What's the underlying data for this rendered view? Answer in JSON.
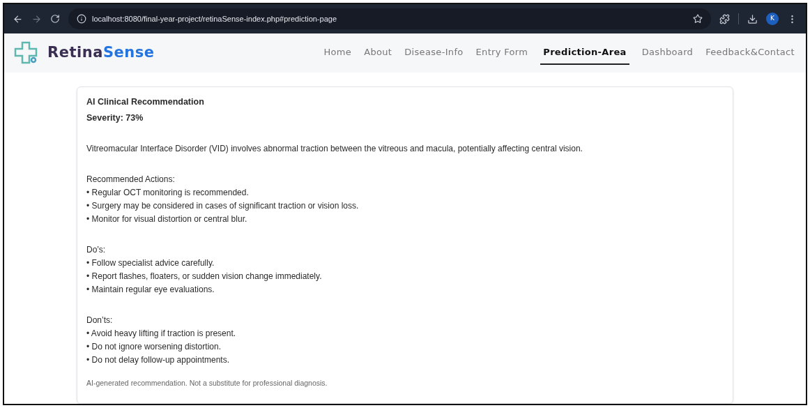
{
  "browser": {
    "url": "localhost:8080/final-year-project/retinaSense-index.php#prediction-page",
    "profile_initial": "K"
  },
  "brand": {
    "part_1": "Retina",
    "part_2": "Sense"
  },
  "nav": [
    {
      "label": "Home",
      "selected": false
    },
    {
      "label": "About",
      "selected": false
    },
    {
      "label": "Disease-Info",
      "selected": false
    },
    {
      "label": "Entry Form",
      "selected": false
    },
    {
      "label": "Prediction-Area",
      "selected": true
    },
    {
      "label": "Dashboard",
      "selected": false
    },
    {
      "label": "Feedback&Contact",
      "selected": false
    }
  ],
  "card": {
    "title": "AI Clinical Recommendation",
    "severity": "Severity: 73%",
    "description": "Vitreomacular Interface Disorder (VID) involves abnormal traction between the vitreous and macula, potentially affecting central vision.",
    "sections": [
      {
        "heading": "Recommended Actions:",
        "items": [
          "• Regular OCT monitoring is recommended.",
          "• Surgery may be considered in cases of significant traction or vision loss.",
          "• Monitor for visual distortion or central blur."
        ]
      },
      {
        "heading": "Do’s:",
        "items": [
          "• Follow specialist advice carefully.",
          "• Report flashes, floaters, or sudden vision change immediately.",
          "• Maintain regular eye evaluations."
        ]
      },
      {
        "heading": "Don’ts:",
        "items": [
          "• Avoid heavy lifting if traction is present.",
          "• Do not ignore worsening distortion.",
          "• Do not delay follow-up appointments."
        ]
      }
    ],
    "disclaimer": "AI-generated recommendation. Not a substitute for professional diagnosis."
  }
}
